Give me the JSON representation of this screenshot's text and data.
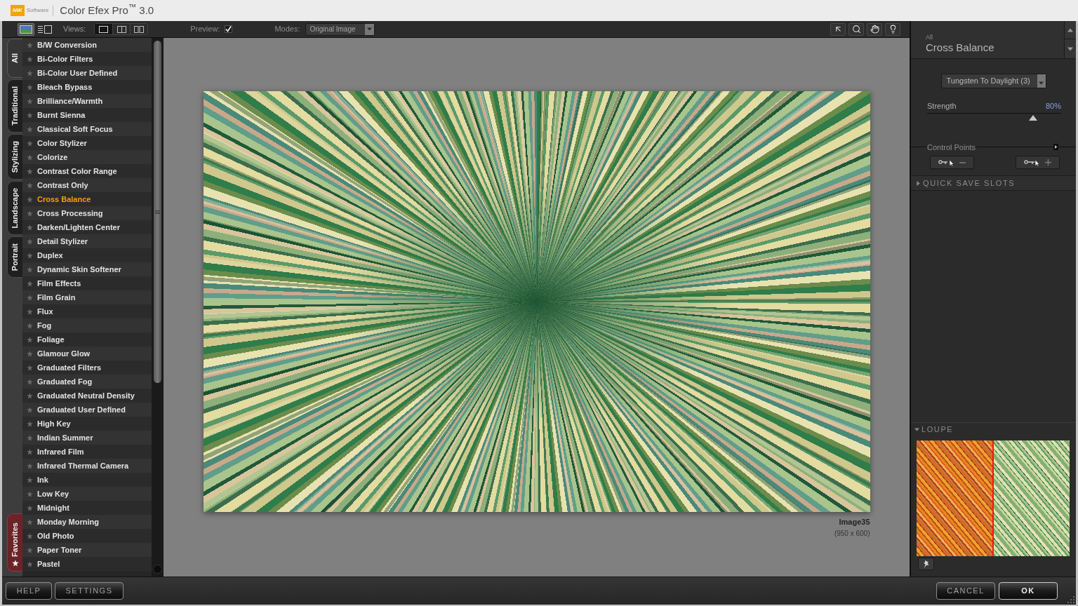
{
  "window": {
    "title": "Color Efex Pro$^{™}$ 3.0",
    "logo": {
      "mark": "NIK",
      "caption": "Software"
    }
  },
  "toolbar": {
    "layouts": [
      {
        "kind": "thumbnail",
        "selected": true
      },
      {
        "kind": "list",
        "selected": false
      }
    ],
    "views_label": "Views:",
    "views": [
      {
        "kind": "single",
        "selected": true
      },
      {
        "kind": "split",
        "selected": false
      },
      {
        "kind": "side_by_side",
        "selected": false
      }
    ],
    "preview": {
      "label": "Preview:",
      "checked": true
    },
    "modes": {
      "label": "Modes:",
      "value": "Original Image"
    },
    "tools": [
      {
        "kind": "pointer"
      },
      {
        "kind": "zoom"
      },
      {
        "kind": "hand"
      },
      {
        "kind": "light"
      }
    ]
  },
  "category_tabs": [
    {
      "label": "All",
      "kind": "category",
      "selected": true
    },
    {
      "label": "Traditional",
      "kind": "category",
      "selected": false
    },
    {
      "label": "Stylizing",
      "kind": "category",
      "selected": false
    },
    {
      "label": "Landscape",
      "kind": "category",
      "selected": false
    },
    {
      "label": "Portrait",
      "kind": "category",
      "selected": false
    },
    {
      "label": "Favorites",
      "kind": "favorites",
      "selected": false
    }
  ],
  "filters": [
    {
      "label": "B/W Conversion",
      "selected": false
    },
    {
      "label": "Bi-Color Filters",
      "selected": false
    },
    {
      "label": "Bi-Color User Defined",
      "selected": false
    },
    {
      "label": "Bleach Bypass",
      "selected": false
    },
    {
      "label": "Brilliance/Warmth",
      "selected": false
    },
    {
      "label": "Burnt Sienna",
      "selected": false
    },
    {
      "label": "Classical Soft Focus",
      "selected": false
    },
    {
      "label": "Color Stylizer",
      "selected": false
    },
    {
      "label": "Colorize",
      "selected": false
    },
    {
      "label": "Contrast Color Range",
      "selected": false
    },
    {
      "label": "Contrast Only",
      "selected": false
    },
    {
      "label": "Cross Balance",
      "selected": true
    },
    {
      "label": "Cross Processing",
      "selected": false
    },
    {
      "label": "Darken/Lighten Center",
      "selected": false
    },
    {
      "label": "Detail Stylizer",
      "selected": false
    },
    {
      "label": "Duplex",
      "selected": false
    },
    {
      "label": "Dynamic Skin Softener",
      "selected": false
    },
    {
      "label": "Film Effects",
      "selected": false
    },
    {
      "label": "Film Grain",
      "selected": false
    },
    {
      "label": "Flux",
      "selected": false
    },
    {
      "label": "Fog",
      "selected": false
    },
    {
      "label": "Foliage",
      "selected": false
    },
    {
      "label": "Glamour Glow",
      "selected": false
    },
    {
      "label": "Graduated Filters",
      "selected": false
    },
    {
      "label": "Graduated Fog",
      "selected": false
    },
    {
      "label": "Graduated Neutral Density",
      "selected": false
    },
    {
      "label": "Graduated User Defined",
      "selected": false
    },
    {
      "label": "High Key",
      "selected": false
    },
    {
      "label": "Indian Summer",
      "selected": false
    },
    {
      "label": "Infrared Film",
      "selected": false
    },
    {
      "label": "Infrared Thermal Camera",
      "selected": false
    },
    {
      "label": "Ink",
      "selected": false
    },
    {
      "label": "Low Key",
      "selected": false
    },
    {
      "label": "Midnight",
      "selected": false
    },
    {
      "label": "Monday Morning",
      "selected": false
    },
    {
      "label": "Old Photo",
      "selected": false
    },
    {
      "label": "Paper Toner",
      "selected": false
    },
    {
      "label": "Pastel",
      "selected": false
    }
  ],
  "image": {
    "name": "Image35",
    "size": "(950 x 600)"
  },
  "filter_panel": {
    "category": "All",
    "title": "Cross Balance",
    "preset": "Tungsten To Daylight (3)",
    "strength": {
      "label": "Strength",
      "reading": "80%",
      "level": 0.79
    },
    "control_points": {
      "label": "Control Points",
      "buttons": [
        {
          "kind": "remove"
        },
        {
          "kind": "add"
        }
      ]
    }
  },
  "quick_save_slots": {
    "label": "QUICK SAVE SLOTS",
    "expanded": false
  },
  "loupe": {
    "label": "LOUPE",
    "expanded": true
  },
  "footer": {
    "left": [
      {
        "label": "HELP",
        "kind": "secondary"
      },
      {
        "label": "SETTINGS",
        "kind": "secondary"
      }
    ],
    "right": [
      {
        "label": "CANCEL",
        "kind": "secondary"
      },
      {
        "label": "OK",
        "kind": "primary"
      }
    ]
  }
}
